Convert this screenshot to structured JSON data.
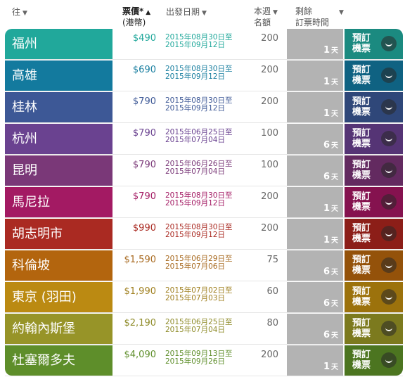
{
  "header": {
    "dest": "往",
    "price_line1": "票價*",
    "price_line2": "(港幣)",
    "date": "出發日期",
    "quota_line1": "本週",
    "quota_line2": "名額",
    "rem_line1": "剩餘",
    "rem_line2": "訂票時間",
    "sort_down": "▼",
    "sort_up": "▲"
  },
  "book_line1": "預訂",
  "book_line2": "機票",
  "day_unit": "天",
  "rows": [
    {
      "dest": "福州",
      "price": "$490",
      "d1": "2015年08月30日至",
      "d2": "2015年09月12日",
      "quota": "200",
      "days": "1",
      "color": "#21a89b",
      "book": "#1b8a80",
      "pcolor": "#21a89b",
      "dcolor": "#21a89b"
    },
    {
      "dest": "高雄",
      "price": "$690",
      "d1": "2015年08月30日至",
      "d2": "2015年09月12日",
      "quota": "200",
      "days": "1",
      "color": "#137a9e",
      "book": "#0f6282",
      "pcolor": "#1a7fa0",
      "dcolor": "#1a7fa0"
    },
    {
      "dest": "桂林",
      "price": "$790",
      "d1": "2015年08月30日至",
      "d2": "2015年09月12日",
      "quota": "200",
      "days": "1",
      "color": "#3d5896",
      "book": "#2f4779",
      "pcolor": "#3d5896",
      "dcolor": "#3d5896"
    },
    {
      "dest": "杭州",
      "price": "$790",
      "d1": "2015年06月25日至",
      "d2": "2015年07月04日",
      "quota": "100",
      "days": "6",
      "color": "#6a4290",
      "book": "#553475",
      "pcolor": "#6a4290",
      "dcolor": "#6a4290"
    },
    {
      "dest": "昆明",
      "price": "$790",
      "d1": "2015年06月26日至",
      "d2": "2015年07月04日",
      "quota": "100",
      "days": "6",
      "color": "#7a3878",
      "book": "#632a60",
      "pcolor": "#7a3878",
      "dcolor": "#7a3878"
    },
    {
      "dest": "馬尼拉",
      "price": "$790",
      "d1": "2015年08月30日至",
      "d2": "2015年09月12日",
      "quota": "200",
      "days": "1",
      "color": "#a31a63",
      "book": "#85124f",
      "pcolor": "#a31a63",
      "dcolor": "#a31a63"
    },
    {
      "dest": "胡志明市",
      "price": "$990",
      "d1": "2015年08月30日至",
      "d2": "2015年09月12日",
      "quota": "200",
      "days": "1",
      "color": "#aa2a22",
      "book": "#8c1e18",
      "pcolor": "#aa2a22",
      "dcolor": "#aa2a22"
    },
    {
      "dest": "科倫坡",
      "price": "$1,590",
      "d1": "2015年06月29日至",
      "d2": "2015年07月06日",
      "quota": "75",
      "days": "6",
      "color": "#b3650e",
      "book": "#94520a",
      "pcolor": "#a86a20",
      "dcolor": "#a86a20"
    },
    {
      "dest": "東京 (羽田)",
      "price": "$1,990",
      "d1": "2015年07月02日至",
      "d2": "2015年07月03日",
      "quota": "60",
      "days": "6",
      "color": "#bb8a12",
      "book": "#9c720c",
      "pcolor": "#a08020",
      "dcolor": "#a08020"
    },
    {
      "dest": "約翰內斯堡",
      "price": "$2,190",
      "d1": "2015年06月25日至",
      "d2": "2015年07月04日",
      "quota": "80",
      "days": "6",
      "color": "#979428",
      "book": "#7c7a1e",
      "pcolor": "#8f8c2a",
      "dcolor": "#8f8c2a"
    },
    {
      "dest": "杜塞爾多夫",
      "price": "$4,090",
      "d1": "2015年09月13日至",
      "d2": "2015年09月26日",
      "quota": "200",
      "days": "1",
      "color": "#5e8e2a",
      "book": "#4c7520",
      "pcolor": "#5e8e2a",
      "dcolor": "#5e8e2a"
    }
  ]
}
